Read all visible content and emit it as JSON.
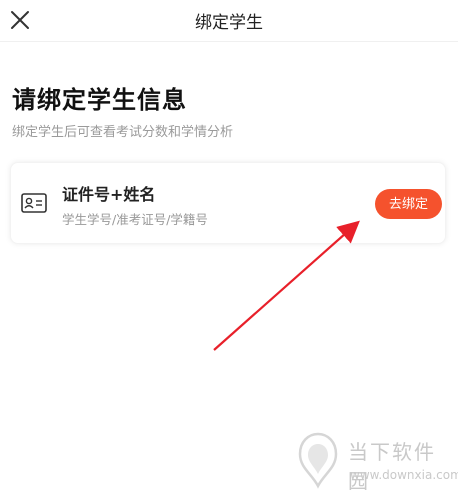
{
  "header": {
    "title": "绑定学生",
    "close_icon": "close-icon"
  },
  "page": {
    "heading": "请绑定学生信息",
    "subheading": "绑定学生后可查看考试分数和学情分析"
  },
  "card": {
    "icon": "id-card-icon",
    "title": "证件号+姓名",
    "description": "学生学号/准考证号/学籍号",
    "button_label": "去绑定"
  },
  "annotation": {
    "arrow_color": "#e8202a"
  },
  "watermark": {
    "name": "当下软件园",
    "url": "www.downxia.com"
  },
  "colors": {
    "accent": "#f5522d"
  }
}
